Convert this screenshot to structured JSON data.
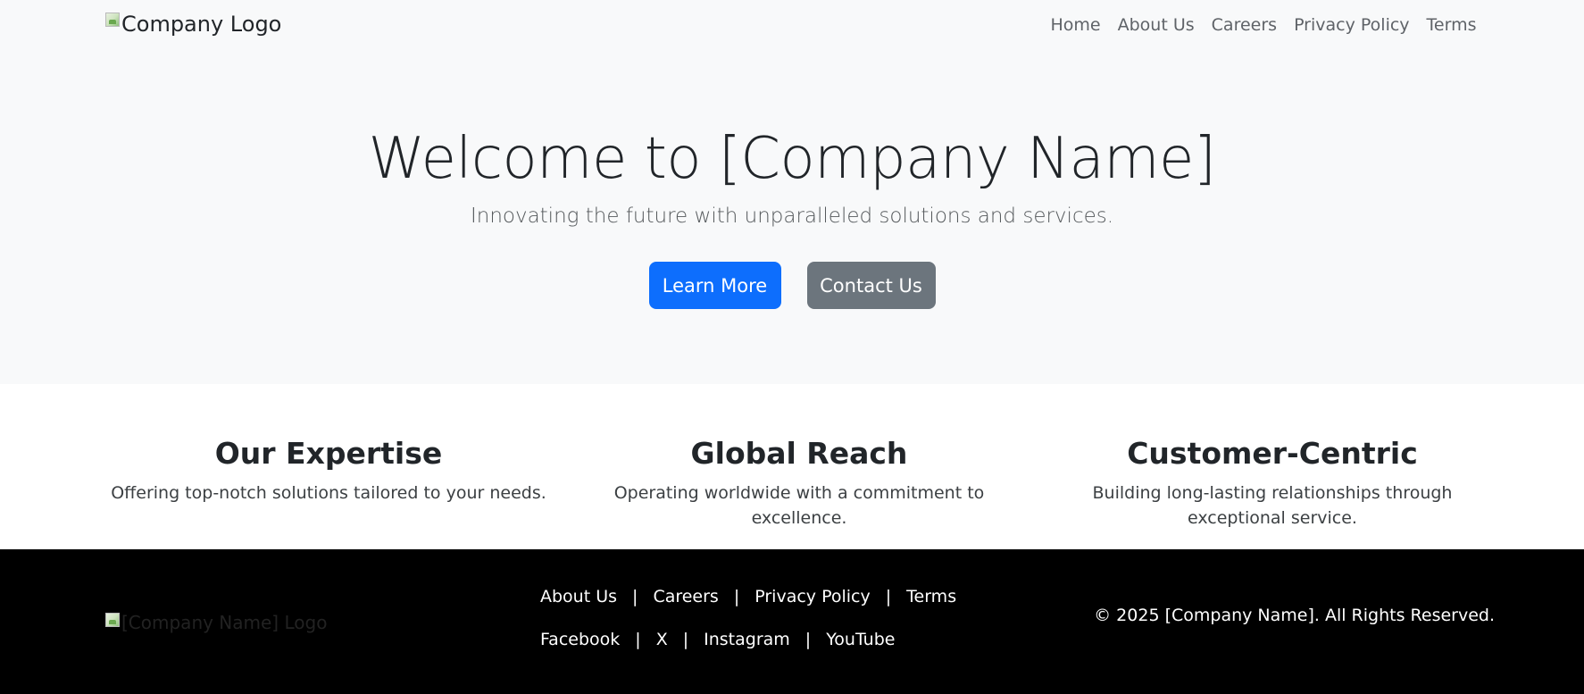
{
  "header": {
    "logo_alt": "Company Logo",
    "nav": [
      {
        "label": "Home"
      },
      {
        "label": "About Us"
      },
      {
        "label": "Careers"
      },
      {
        "label": "Privacy Policy"
      },
      {
        "label": "Terms"
      }
    ]
  },
  "hero": {
    "title": "Welcome to [Company Name]",
    "subtitle": "Innovating the future with unparalleled solutions and services.",
    "primary_button": "Learn More",
    "secondary_button": "Contact Us"
  },
  "features": [
    {
      "title": "Our Expertise",
      "text": "Offering top-notch solutions tailored to your needs."
    },
    {
      "title": "Global Reach",
      "text": "Operating worldwide with a commitment to excellence."
    },
    {
      "title": "Customer-Centric",
      "text": "Building long-lasting relationships through exceptional service."
    }
  ],
  "footer": {
    "logo_alt": "[Company Name] Logo",
    "links": [
      {
        "label": "About Us"
      },
      {
        "label": "Careers"
      },
      {
        "label": "Privacy Policy"
      },
      {
        "label": "Terms"
      }
    ],
    "social": [
      {
        "label": "Facebook"
      },
      {
        "label": "X"
      },
      {
        "label": "Instagram"
      },
      {
        "label": "YouTube"
      }
    ],
    "separator": "|",
    "copyright": "© 2025 [Company Name]. All Rights Reserved."
  },
  "colors": {
    "primary": "#0d6efd",
    "secondary": "#6c757d",
    "header_bg": "#f8f9fa",
    "footer_bg": "#000000"
  }
}
